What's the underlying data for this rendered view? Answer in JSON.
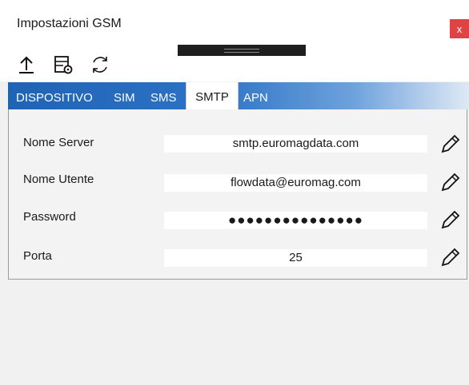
{
  "window": {
    "title": "Impostazioni GSM",
    "close_label": "x"
  },
  "toolbar": {
    "icons": [
      "upload-icon",
      "settings-file-icon",
      "refresh-icon"
    ]
  },
  "tabs": [
    {
      "label": "DISPOSITIVO",
      "active": false
    },
    {
      "label": "SIM",
      "active": false
    },
    {
      "label": "SMS",
      "active": false
    },
    {
      "label": "SMTP",
      "active": true
    },
    {
      "label": "APN",
      "active": false
    }
  ],
  "fields": [
    {
      "label": "Nome Server",
      "value": "smtp.euromagdata.com"
    },
    {
      "label": "Nome Utente",
      "value": "flowdata@euromag.com"
    },
    {
      "label": "Password",
      "value": "●●●●●●●●●●●●●●●"
    },
    {
      "label": "Porta",
      "value": "25"
    }
  ],
  "colors": {
    "tab_gradient_start": "#1f63b5",
    "tab_gradient_end": "#dfe9f5",
    "close_button": "#e04343"
  }
}
